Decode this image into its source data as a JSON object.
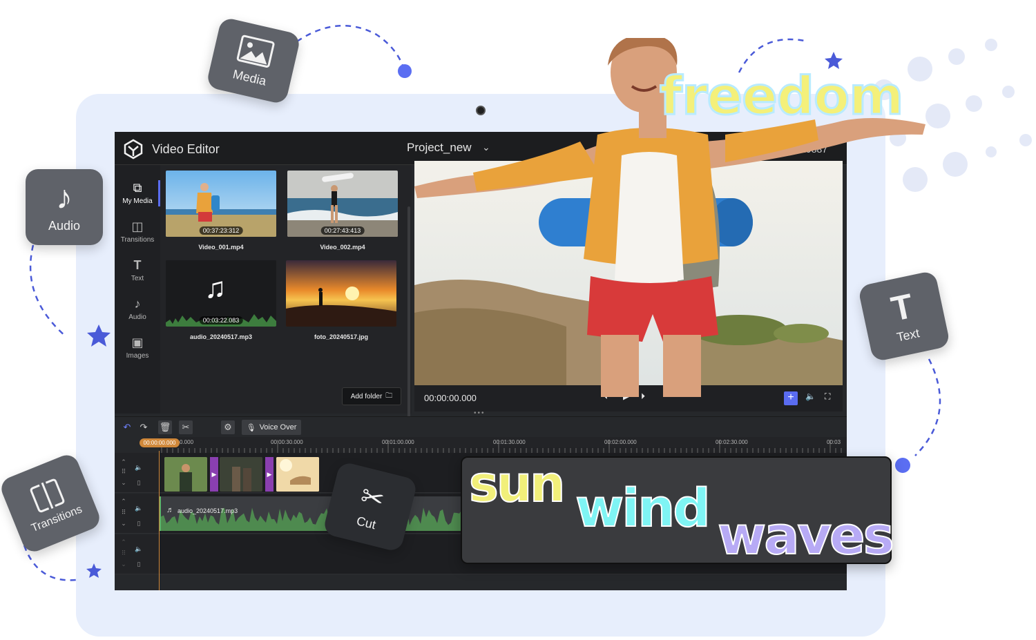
{
  "tiles": {
    "media": "Media",
    "audio": "Audio",
    "text": "Text",
    "transitions": "Transitions",
    "cut": "Cut"
  },
  "editor": {
    "app_title": "Video Editor",
    "project_name": "Project_new",
    "project_code": "0:00:19887"
  },
  "sidebar": {
    "items": [
      {
        "label": "My Media",
        "icon": "media-library-icon"
      },
      {
        "label": "Transitions",
        "icon": "transitions-icon"
      },
      {
        "label": "Text",
        "icon": "text-icon"
      },
      {
        "label": "Audio",
        "icon": "music-note-icon"
      },
      {
        "label": "Images",
        "icon": "image-icon"
      }
    ]
  },
  "media": {
    "items": [
      {
        "name": "Video_001.mp4",
        "duration": "00:37:23:312"
      },
      {
        "name": "Video_002.mp4",
        "duration": "00:27:43:413"
      },
      {
        "name": "audio_20240517.mp3",
        "duration": "00:03:22.083"
      },
      {
        "name": "foto_20240517.jpg",
        "duration": ""
      }
    ],
    "add_folder": "Add folder"
  },
  "player": {
    "timecode": "00:00:00.000"
  },
  "timeline": {
    "voice_over": "Voice Over",
    "playhead": "00:00:00.000",
    "ruler": [
      "00:00:00.000",
      "00:00:30.000",
      "00:01:00.000",
      "00:01:30.000",
      "00:02:00.000",
      "00:02:30.000",
      "00:03"
    ],
    "audio_clip": "audio_20240517.mp3"
  },
  "overlay_text": {
    "freedom": "freedom",
    "sun": "sun",
    "wind": "wind",
    "waves": "waves"
  }
}
